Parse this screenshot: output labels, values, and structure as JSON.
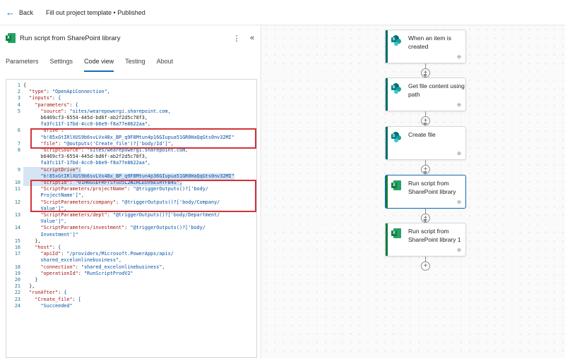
{
  "topbar": {
    "back_label": "Back",
    "breadcrumb": "Fill out project template • Published"
  },
  "panel": {
    "title": "Run script from SharePoint library",
    "more": "⋮",
    "collapse": "«",
    "tabs": [
      "Parameters",
      "Settings",
      "Code view",
      "Testing",
      "About"
    ],
    "active_tab": "Code view"
  },
  "code": {
    "line_numbers": [
      "1",
      "2",
      "3",
      "4",
      "5",
      "",
      "",
      "6",
      "",
      "7",
      "8",
      "",
      "",
      "9",
      "",
      "10",
      "11",
      "",
      "12",
      "",
      "13",
      "",
      "14",
      "",
      "15",
      "16",
      "17",
      "",
      "18",
      "19",
      "20",
      "21",
      "22",
      "23",
      "24"
    ],
    "lines": [
      "{",
      "  \"type\": \"OpenApiConnection\",",
      "  \"inputs\": {",
      "    \"parameters\": {",
      "      \"source\": \"sites/wearepowergi.sharepoint.com,",
      "      b6469cf3-6554-445d-bd6f-ab2f2d5c78f3,",
      "      fa3fc11f-17bd-4cc0-b6e9-f8a77e8622aa\",",
      "      \"drive\":",
      "      \"b!85xGtIRlXUS9b6svLVx48x_BP_q9F8Mtun4p16GIupua51GR0HaQqGts0nv32MI\"",
      "      \"file\": \"@outputs('Create_file')?['body/Id']\",",
      "      \"scriptSource\": \"sites/wearepowergi.sharepoint.com,",
      "      b6469cf3-6554-445d-bd6f-ab2f2d5c78f3,",
      "      fa3fc11f-17bd-4cc0-b6e9-f8a77e8622aa\",",
      "      \"scriptDrive\":",
      "      \"b!85xGtIRlXUS9b6svLVx48x_BP_q9F8Mtun4p36GIupua51GR0HaQqGts0nv32MI\"",
      "      \"scriptId\": \"01H6GSEFRFTSYSO5L2WZHLEUV6ESRYFB4S\",",
      "      \"ScriptParameters/projectName\": \"@triggerOutputs()?['body/",
      "      ProjectName']\",",
      "      \"ScriptParameters/company\": \"@triggerOutputs()?['body/Company/",
      "      Value']\",",
      "      \"ScriptParameters/dept\": \"@triggerOutputs()?['body/Department/",
      "      Value']\",",
      "      \"ScriptParameters/investment\": \"@triggerOutputs()?['body/",
      "      Investment']\"",
      "    },",
      "    \"host\": {",
      "      \"apiId\": \"/providers/Microsoft.PowerApps/apis/",
      "      shared_excelonlinebusiness\",",
      "      \"connection\": \"shared_excelonlinebusiness\",",
      "      \"operationId\": \"RunScriptProdV2\"",
      "    }",
      "  },",
      "  \"runAfter\": {",
      "    \"Create_file\": [",
      "      \"Succeeded\""
    ]
  },
  "flow": {
    "cards": [
      {
        "label": "When an item is created",
        "icon": "sharepoint-icon",
        "strip": "#036c70"
      },
      {
        "label": "Get file content using path",
        "icon": "sharepoint-icon",
        "strip": "#036c70"
      },
      {
        "label": "Create file",
        "icon": "sharepoint-icon",
        "strip": "#036c70"
      },
      {
        "label": "Run script from SharePoint library",
        "icon": "excel-icon",
        "strip": "#107c41"
      },
      {
        "label": "Run script from SharePoint library 1",
        "icon": "excel-icon",
        "strip": "#107c41"
      }
    ],
    "plus_symbol": "+",
    "link_symbol": "⊖"
  },
  "colors": {
    "accent": "#0f6cbd",
    "highlight_box": "#d13438",
    "excel": "#107c41",
    "sharepoint": "#036c70"
  }
}
